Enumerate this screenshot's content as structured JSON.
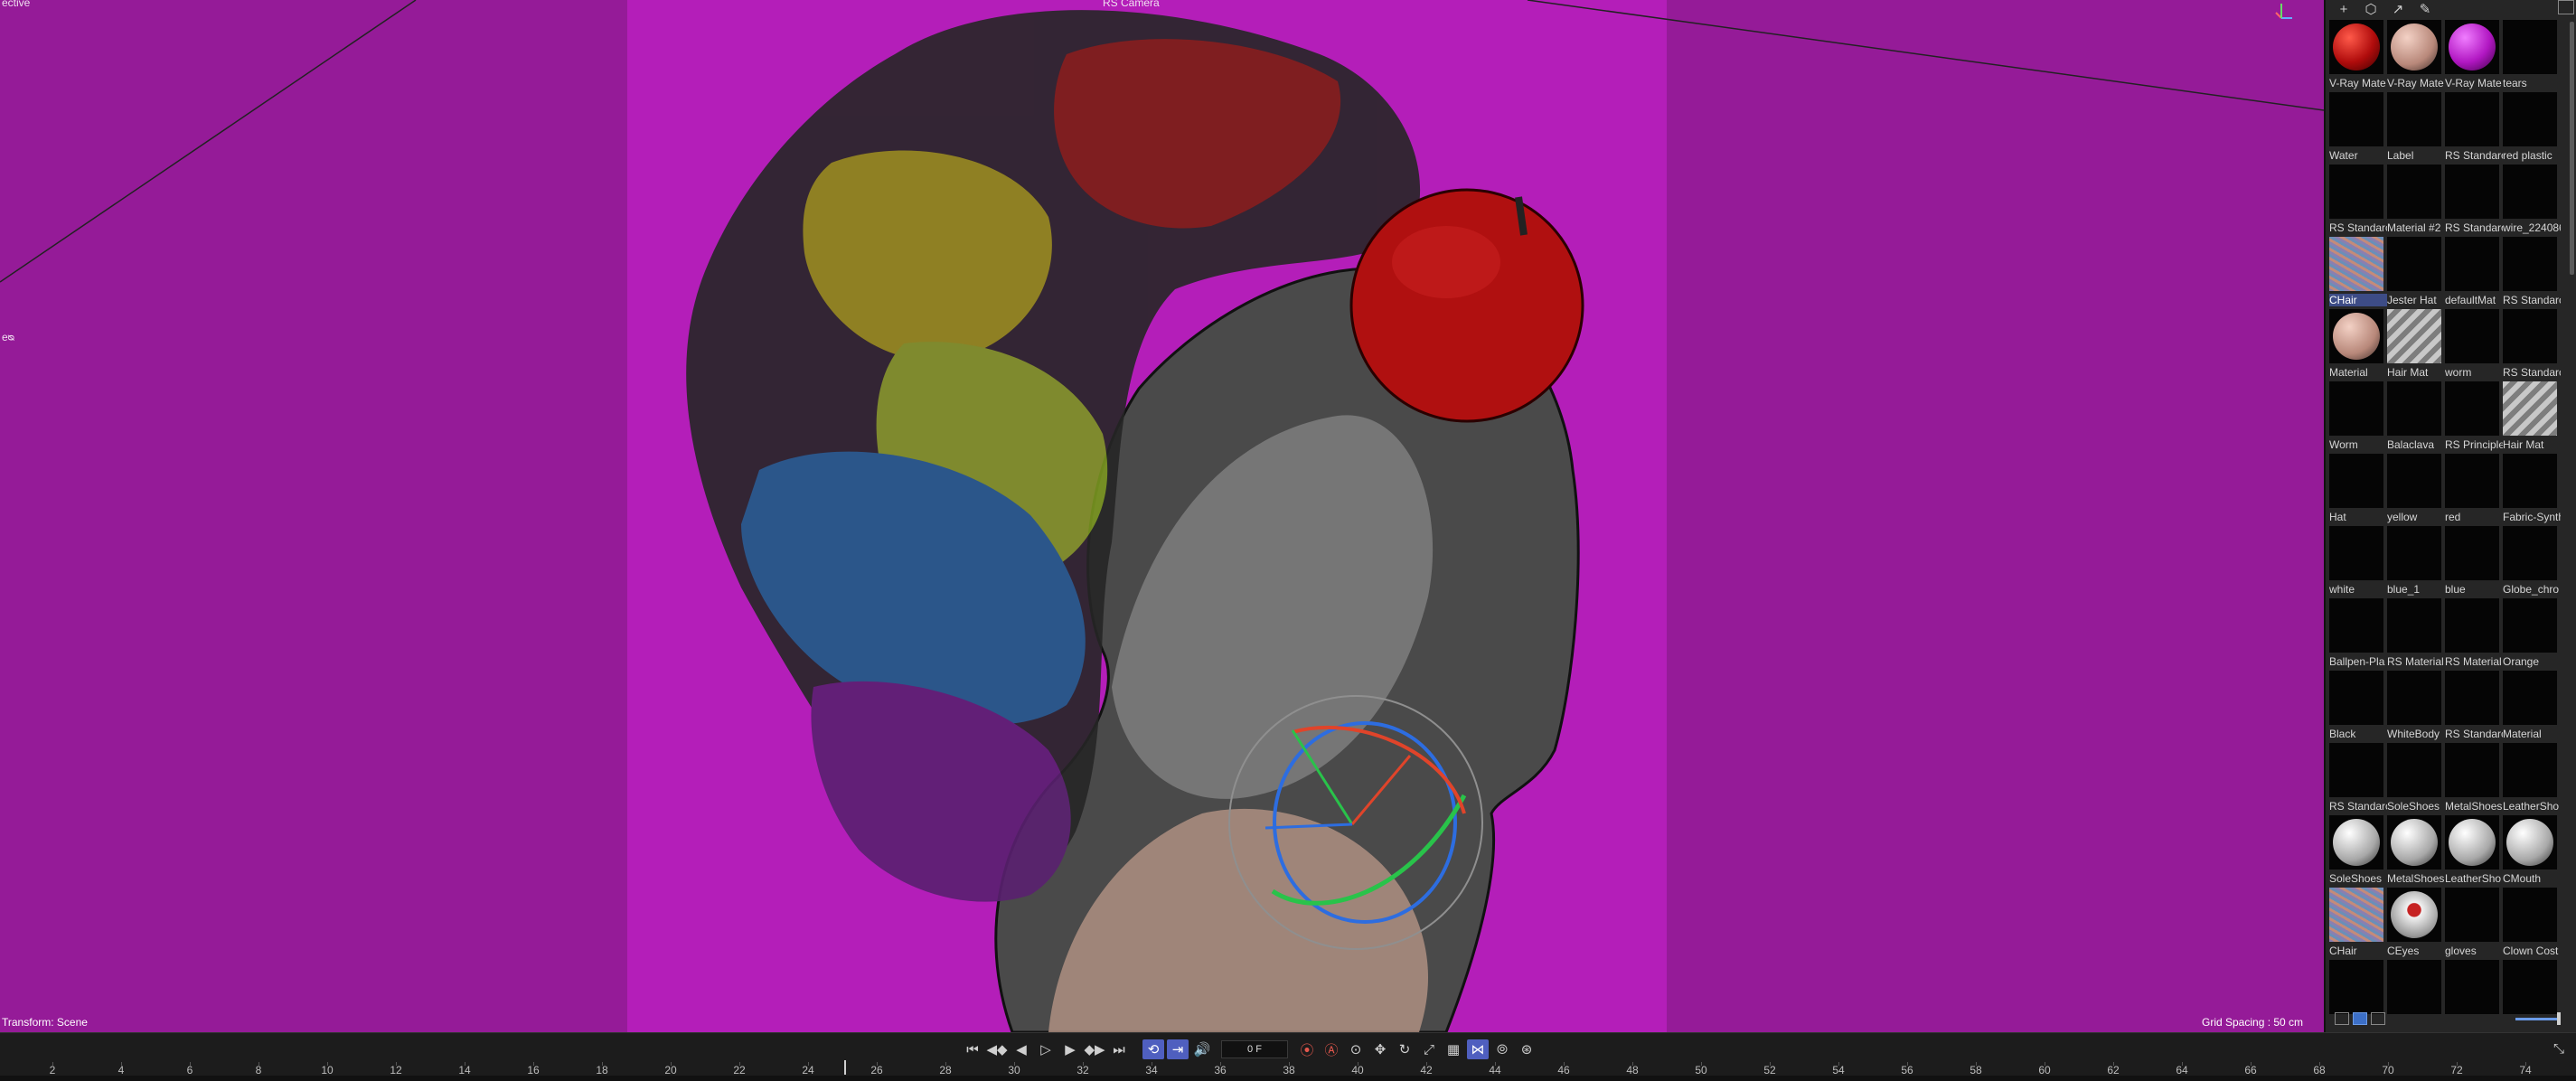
{
  "viewport": {
    "top_left_label": "ective",
    "top_center_label": "RS Camera",
    "left_marker": "eᴓ",
    "status_left": "Transform: Scene",
    "status_right": "Grid Spacing : 50 cm",
    "colors": {
      "background": "#951b98",
      "safe_frame": "#b41eb9"
    }
  },
  "material_panel": {
    "toolbar_icons": [
      "plus-icon",
      "cube-icon",
      "arrow-icon",
      "eyedropper-icon"
    ],
    "materials": [
      {
        "label": "V-Ray Mate",
        "preview": "red-sphere"
      },
      {
        "label": "V-Ray Mate",
        "preview": "skin-sphere"
      },
      {
        "label": "V-Ray Mate",
        "preview": "purple-sphere"
      },
      {
        "label": "tears",
        "preview": "empty"
      },
      {
        "label": "Water",
        "preview": "empty"
      },
      {
        "label": "Label",
        "preview": "empty"
      },
      {
        "label": "RS Standarc",
        "preview": "empty"
      },
      {
        "label": "red plastic",
        "preview": "empty"
      },
      {
        "label": "RS Standarc",
        "preview": "empty"
      },
      {
        "label": "Material #2",
        "preview": "empty"
      },
      {
        "label": "RS Standarc",
        "preview": "empty"
      },
      {
        "label": "wire_224086",
        "preview": "empty"
      },
      {
        "label": "CHair",
        "preview": "hair-texture",
        "selected": true
      },
      {
        "label": "Jester Hat",
        "preview": "empty"
      },
      {
        "label": "defaultMat",
        "preview": "empty"
      },
      {
        "label": "RS Standarc",
        "preview": "empty"
      },
      {
        "label": "Material",
        "preview": "skin-sphere"
      },
      {
        "label": "Hair Mat",
        "preview": "stripe-texture"
      },
      {
        "label": "worm",
        "preview": "empty"
      },
      {
        "label": "RS Standarc",
        "preview": "empty"
      },
      {
        "label": "Worm",
        "preview": "empty"
      },
      {
        "label": "Balaclava",
        "preview": "empty"
      },
      {
        "label": "RS Principle",
        "preview": "empty"
      },
      {
        "label": "Hair Mat",
        "preview": "stripe-texture"
      },
      {
        "label": "Hat",
        "preview": "empty"
      },
      {
        "label": "yellow",
        "preview": "empty"
      },
      {
        "label": "red",
        "preview": "empty"
      },
      {
        "label": "Fabric-Synth",
        "preview": "empty"
      },
      {
        "label": "white",
        "preview": "empty"
      },
      {
        "label": "blue_1",
        "preview": "empty"
      },
      {
        "label": "blue",
        "preview": "empty"
      },
      {
        "label": "Globe_chro",
        "preview": "empty"
      },
      {
        "label": "Ballpen-Pla",
        "preview": "empty"
      },
      {
        "label": "RS Material",
        "preview": "empty"
      },
      {
        "label": "RS Material",
        "preview": "empty"
      },
      {
        "label": "Orange",
        "preview": "empty"
      },
      {
        "label": "Black",
        "preview": "empty"
      },
      {
        "label": "WhiteBody",
        "preview": "empty"
      },
      {
        "label": "RS Standarc",
        "preview": "empty"
      },
      {
        "label": "Material",
        "preview": "empty"
      },
      {
        "label": "RS Standarc",
        "preview": "empty"
      },
      {
        "label": "SoleShoes",
        "preview": "empty"
      },
      {
        "label": "MetalShoes",
        "preview": "empty"
      },
      {
        "label": "LeatherSho",
        "preview": "empty"
      },
      {
        "label": "SoleShoes",
        "preview": "white-sphere"
      },
      {
        "label": "MetalShoes",
        "preview": "white-sphere"
      },
      {
        "label": "LeatherSho",
        "preview": "white-sphere"
      },
      {
        "label": "CMouth",
        "preview": "white-sphere"
      },
      {
        "label": "CHair",
        "preview": "hair-texture"
      },
      {
        "label": "CEyes",
        "preview": "eye-sphere"
      },
      {
        "label": "gloves",
        "preview": "empty"
      },
      {
        "label": "Clown Cost",
        "preview": "empty"
      },
      {
        "label": "",
        "preview": "empty"
      },
      {
        "label": "",
        "preview": "empty"
      },
      {
        "label": "",
        "preview": "empty"
      },
      {
        "label": "",
        "preview": "empty"
      }
    ]
  },
  "timeline": {
    "frame_value": "0 F",
    "ruler_labels": [
      "2",
      "4",
      "6",
      "8",
      "10",
      "12",
      "14",
      "16",
      "18",
      "20",
      "22",
      "24",
      "26",
      "28",
      "30",
      "32",
      "34",
      "36",
      "38",
      "40",
      "42",
      "44",
      "46",
      "48",
      "50",
      "52",
      "54",
      "56",
      "58",
      "60",
      "62",
      "64",
      "66",
      "68",
      "70",
      "72",
      "74"
    ],
    "controls": [
      {
        "name": "go-to-start-icon",
        "glyph": "⏮"
      },
      {
        "name": "previous-key-icon",
        "glyph": "◀◆"
      },
      {
        "name": "step-back-icon",
        "glyph": "◀"
      },
      {
        "name": "play-icon",
        "glyph": "▷"
      },
      {
        "name": "step-forward-icon",
        "glyph": "▶"
      },
      {
        "name": "next-key-icon",
        "glyph": "◆▶"
      },
      {
        "name": "go-to-end-icon",
        "glyph": "⏭"
      }
    ],
    "mode_controls": [
      {
        "name": "loop-icon",
        "glyph": "⟲",
        "active": true
      },
      {
        "name": "range-icon",
        "glyph": "⇥",
        "active": true
      },
      {
        "name": "sound-icon",
        "glyph": "🔊",
        "active": false
      }
    ],
    "key_controls": [
      {
        "name": "record-icon",
        "glyph": "⦿",
        "rec": true
      },
      {
        "name": "auto-key-icon",
        "glyph": "Ⓐ",
        "rec": true
      },
      {
        "name": "key-settings-icon",
        "glyph": "⊙",
        "rec": false
      },
      {
        "name": "position-key-icon",
        "glyph": "✥",
        "rec": false
      },
      {
        "name": "rotation-key-icon",
        "glyph": "↻",
        "rec": false
      },
      {
        "name": "scale-key-icon",
        "glyph": "⤢",
        "rec": false
      },
      {
        "name": "parameter-key-icon",
        "glyph": "▦",
        "rec": false
      },
      {
        "name": "point-level-icon",
        "glyph": "⋈",
        "active": true
      },
      {
        "name": "motion-icon",
        "glyph": "⦾",
        "rec": false
      },
      {
        "name": "tangent-icon",
        "glyph": "⊛",
        "rec": false
      }
    ]
  }
}
